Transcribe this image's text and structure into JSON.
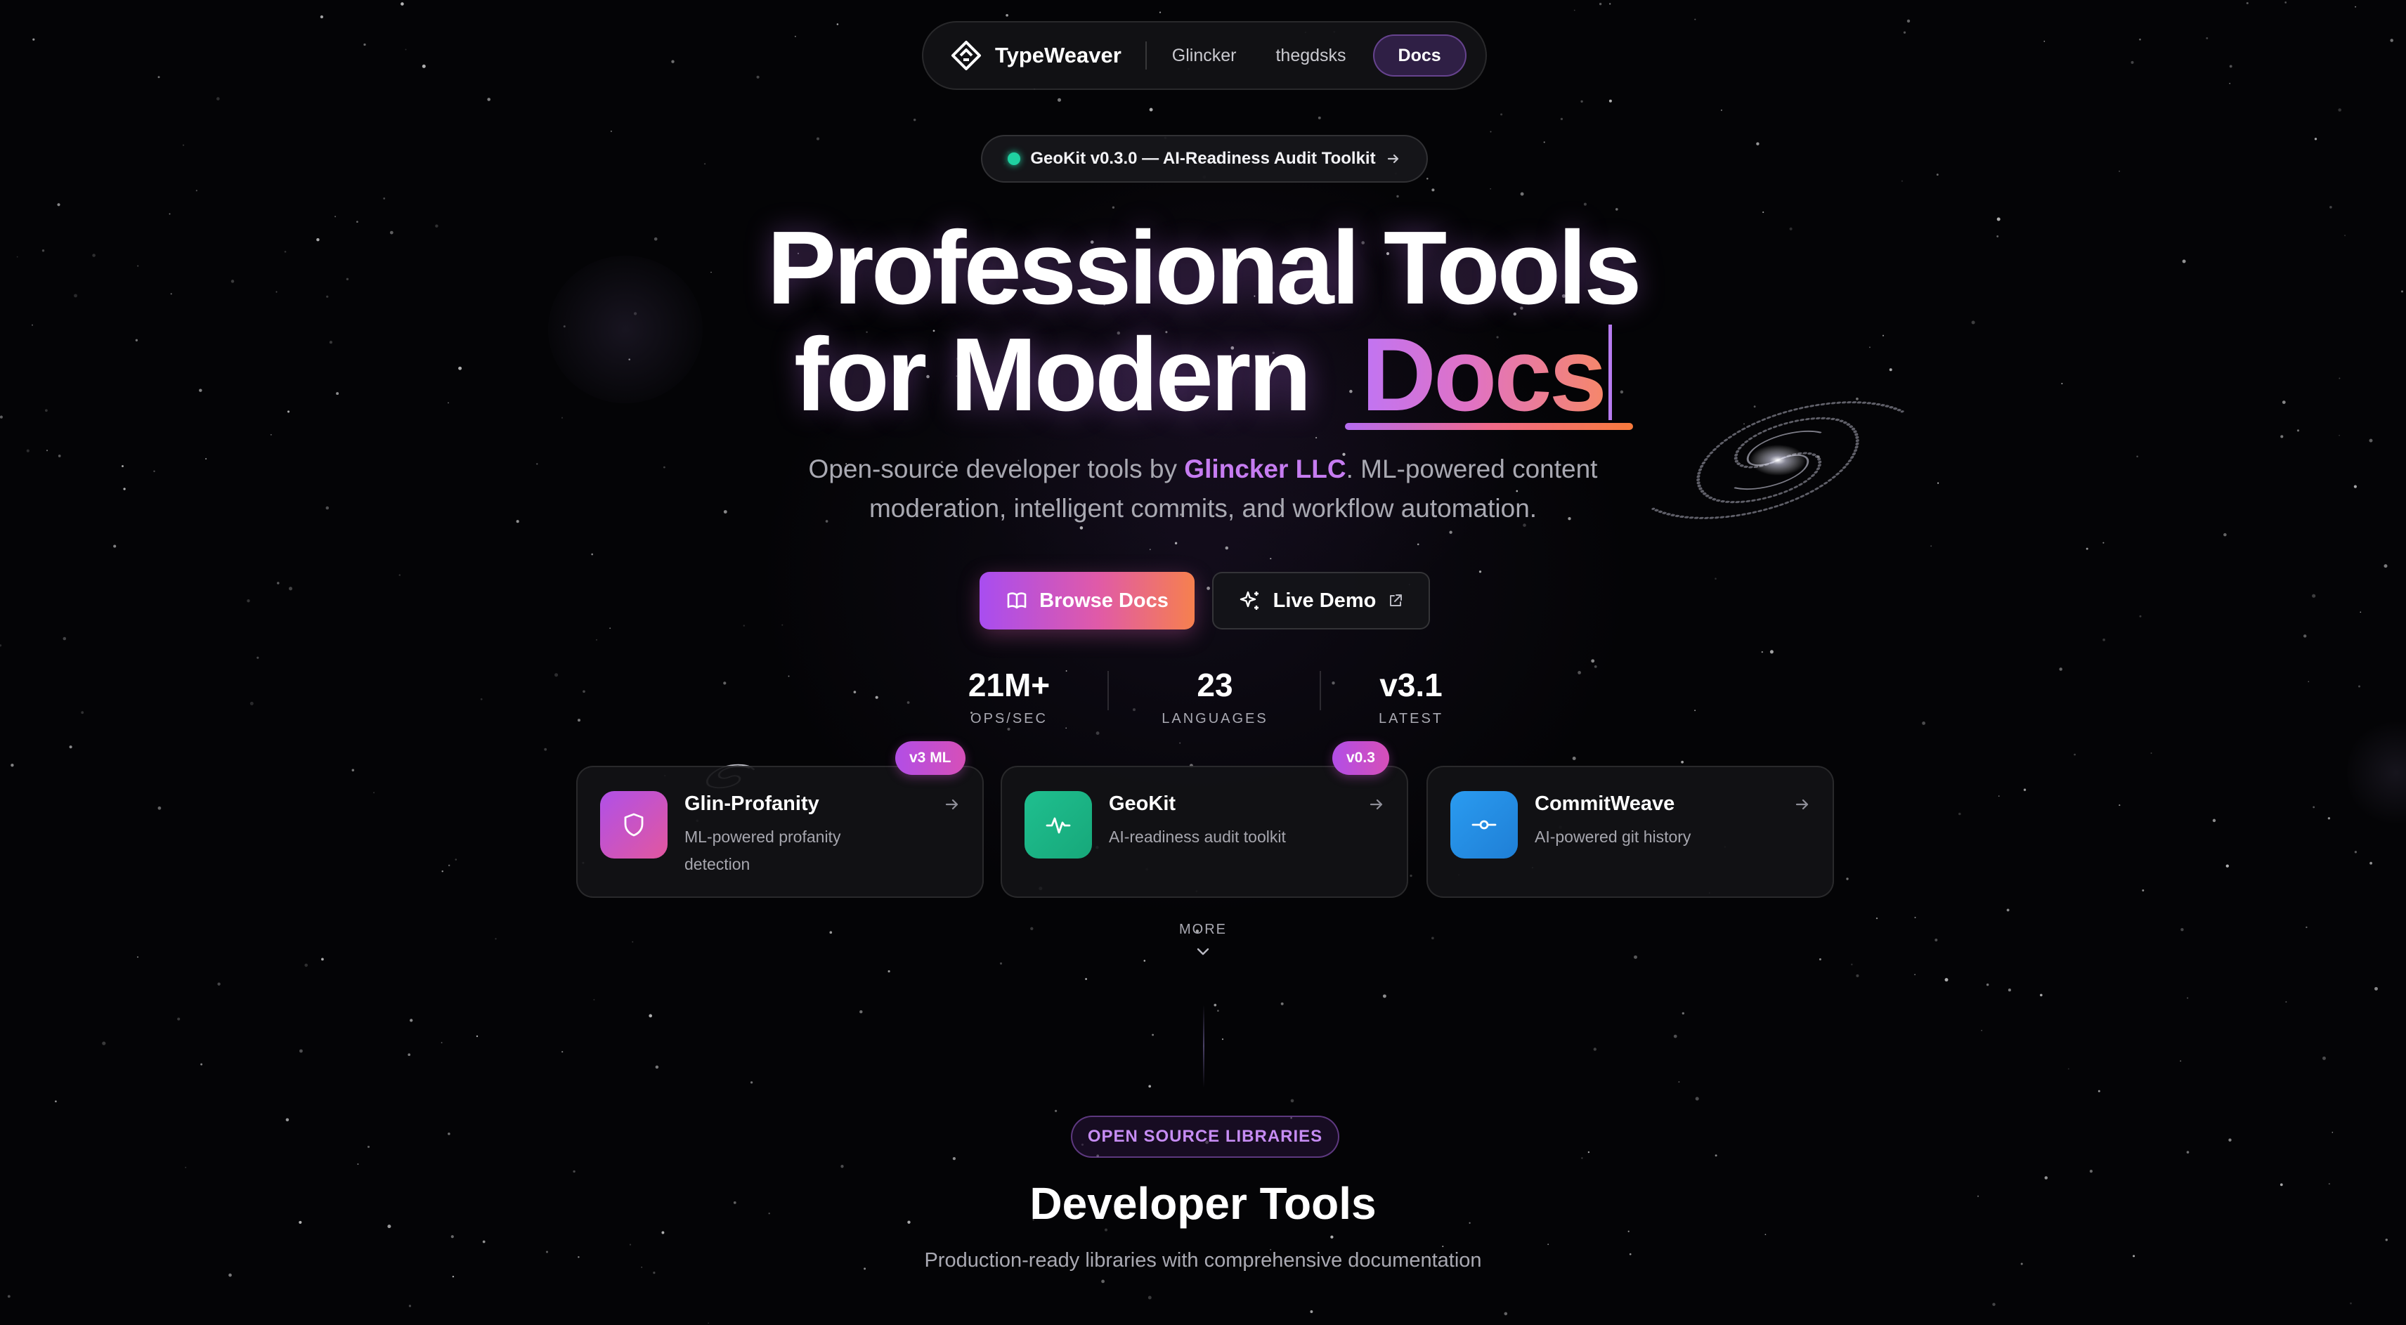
{
  "nav": {
    "brand": "TypeWeaver",
    "links": [
      "Glincker",
      "thegdsks"
    ],
    "active": "Docs"
  },
  "announcement": {
    "text": "GeoKit v0.3.0 — AI-Readiness Audit Toolkit",
    "status_color": "#1fd1a1"
  },
  "hero": {
    "line1": "Professional Tools",
    "line2_prefix": "for Modern",
    "line2_highlight": "Docs",
    "subtitle_part1": "Open-source developer tools by",
    "subtitle_highlight": "Glincker LLC",
    "subtitle_part2": ". ML-powered content",
    "subtitle_line2": "moderation, intelligent commits, and workflow automation."
  },
  "buttons": {
    "primary": "Browse Docs",
    "secondary": "Live Demo"
  },
  "stats": [
    {
      "value": "21M+",
      "label": "OPS/SEC"
    },
    {
      "value": "23",
      "label": "LANGUAGES"
    },
    {
      "value": "v3.1",
      "label": "LATEST"
    }
  ],
  "cards": [
    {
      "title": "Glin-Profanity",
      "desc": "ML-powered profanity detection",
      "badge": "v3 ML",
      "icon": "shield-icon"
    },
    {
      "title": "GeoKit",
      "desc": "AI-readiness audit toolkit",
      "badge": "v0.3",
      "icon": "pulse-icon"
    },
    {
      "title": "CommitWeave",
      "desc": "AI-powered git history",
      "badge": "",
      "icon": "git-commit-icon"
    }
  ],
  "more_label": "MORE",
  "section": {
    "badge": "OPEN SOURCE LIBRARIES",
    "title": "Developer Tools",
    "subtitle": "Production-ready libraries with comprehensive documentation"
  },
  "colors": {
    "accent_purple": "#c67cf1",
    "gradient_start": "#a84df0",
    "gradient_end": "#f6804e",
    "geokit_green": "#1cb98a",
    "commitweave_blue": "#2a92e6"
  }
}
